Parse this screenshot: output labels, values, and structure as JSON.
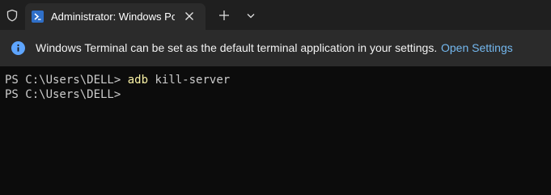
{
  "tab": {
    "title": "Administrator: Windows PowerShell",
    "icon": "powershell-icon"
  },
  "titlebar": {
    "shield_icon": "shield-icon",
    "close_icon": "close-icon",
    "new_tab_icon": "plus-icon",
    "dropdown_icon": "chevron-down-icon"
  },
  "infobar": {
    "icon": "info-icon",
    "message": "Windows Terminal can be set as the default terminal application in your settings.",
    "link": "Open Settings"
  },
  "terminal": {
    "lines": [
      {
        "prompt": "PS C:\\Users\\DELL>",
        "command": "adb",
        "args": "kill-server"
      },
      {
        "prompt": "PS C:\\Users\\DELL>",
        "command": "",
        "args": ""
      }
    ]
  },
  "colors": {
    "terminal_bg": "#0c0c0c",
    "titlebar_bg": "#1f1f1f",
    "tab_bg": "#2b2b2b",
    "accent_link": "#74b8ef",
    "info_icon": "#5ea5ff",
    "command_yellow": "#f9f1a5"
  }
}
